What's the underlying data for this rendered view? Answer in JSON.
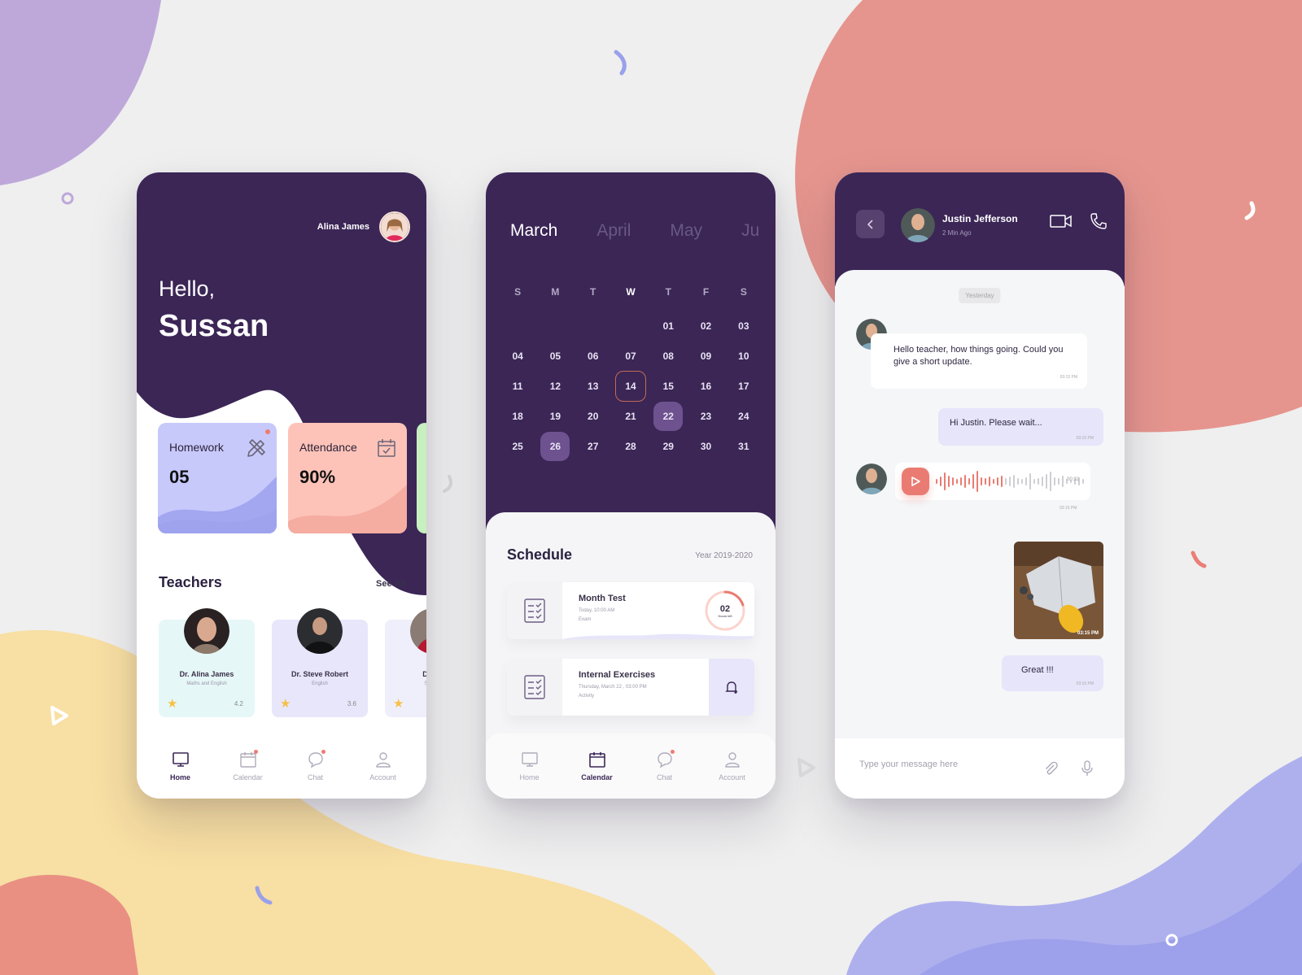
{
  "colors": {
    "primary": "#3b2656",
    "homework_card": "#c7c9fb",
    "attendance_card": "#fdc3b9",
    "accent_red": "#ea7b72",
    "selected_day": "#6e528f",
    "today_ring": "#c46a55",
    "star": "#f7c145"
  },
  "home": {
    "user_name": "Alina James",
    "greeting": "Hello,",
    "student_name": "Sussan",
    "stats": [
      {
        "label": "Homework",
        "value": "05",
        "icon": "pencil-ruler-icon"
      },
      {
        "label": "Attendance",
        "value": "90%",
        "icon": "calendar-check-icon"
      }
    ],
    "teachers_title": "Teachers",
    "see_all": "See All",
    "teachers": [
      {
        "name": "Dr. Alina James",
        "subject": "Maths and English",
        "rating": "4.2"
      },
      {
        "name": "Dr. Steve Robert",
        "subject": "English",
        "rating": "3.6"
      },
      {
        "name": "Dr. Se",
        "subject": "Science",
        "rating": ""
      }
    ],
    "nav": [
      {
        "label": "Home",
        "icon": "monitor-icon",
        "active": true
      },
      {
        "label": "Calendar",
        "icon": "calendar-icon",
        "active": false
      },
      {
        "label": "Chat",
        "icon": "chat-icon",
        "active": false
      },
      {
        "label": "Account",
        "icon": "user-icon",
        "active": false
      }
    ]
  },
  "calendar": {
    "months": [
      "March",
      "April",
      "May",
      "Ju"
    ],
    "active_month": "March",
    "weekdays": [
      "S",
      "M",
      "T",
      "W",
      "T",
      "F",
      "S"
    ],
    "leading_blanks": 4,
    "days": [
      "01",
      "02",
      "03",
      "04",
      "05",
      "06",
      "07",
      "08",
      "09",
      "10",
      "11",
      "12",
      "13",
      "14",
      "15",
      "16",
      "17",
      "18",
      "19",
      "20",
      "21",
      "22",
      "23",
      "24",
      "25",
      "26",
      "27",
      "28",
      "29",
      "30",
      "31"
    ],
    "today": "14",
    "selected": [
      "22",
      "26"
    ],
    "schedule_title": "Schedule",
    "schedule_year": "Year 2019-2020",
    "events": [
      {
        "title": "Month Test",
        "when": "Today,  10:00 AM",
        "type": "Exam",
        "countdown_value": "02",
        "countdown_label": "Hours left",
        "countdown_progress": 0.2
      },
      {
        "title": "Internal Exercises",
        "when": "Thursday, March 22 ,  03:00 PM",
        "type": "Activity",
        "action_icon": "bell-plus-icon"
      }
    ],
    "nav": [
      {
        "label": "Home",
        "active": false
      },
      {
        "label": "Calendar",
        "active": true
      },
      {
        "label": "Chat",
        "active": false
      },
      {
        "label": "Account",
        "active": false
      }
    ]
  },
  "chat": {
    "contact_name": "Justin Jefferson",
    "contact_status": "2 Min Ago",
    "day_label": "Yesterday",
    "messages": [
      {
        "from": "them",
        "kind": "text",
        "text": "Hello teacher, how things going. Could you give a short update.",
        "time": "03:15 PM"
      },
      {
        "from": "me",
        "kind": "text",
        "text": "Hi Justin. Please wait...",
        "time": "03:15 PM"
      },
      {
        "from": "them",
        "kind": "voice",
        "duration": "00:32",
        "time": "03:15 PM",
        "played_fraction": 0.45
      },
      {
        "from": "me",
        "kind": "image",
        "time": "03:15 PM"
      },
      {
        "from": "me",
        "kind": "text",
        "text": "Great !!!",
        "time": "03:15 PM"
      }
    ],
    "compose_placeholder": "Type your message here"
  }
}
